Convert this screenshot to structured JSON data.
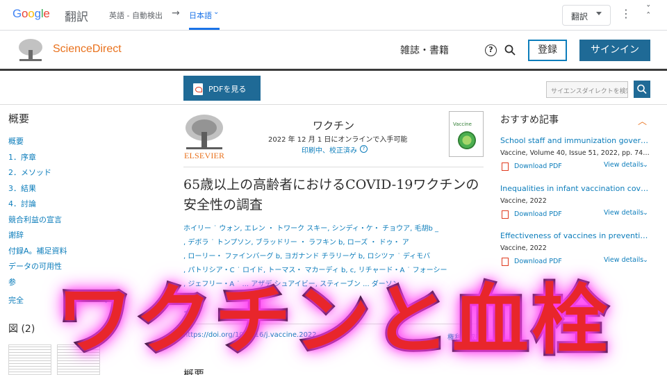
{
  "google_translate": {
    "logo": "Google",
    "service": "翻訳",
    "source_lang": "英語 - 自動検出",
    "arrow": "→",
    "target_lang": "日本語",
    "translate_button": "翻訳",
    "more_icon": "more-vert-icon",
    "collapse_icon": "collapse-icon",
    "logo_colors": [
      "#4285f4",
      "#ea4335",
      "#fbbc05",
      "#4285f4",
      "#34a853",
      "#ea4335"
    ]
  },
  "header": {
    "site_name": "ScienceDirect",
    "journals_books": "雑誌・書籍",
    "help_label": "?",
    "register": "登録",
    "sign_in": "サインイン",
    "accent_color": "#e9711c",
    "button_color": "#1f6a96"
  },
  "toolbar": {
    "pdf_button": "PDFを見る",
    "search_placeholder": "サイエンスダイレクトを検索"
  },
  "outline": {
    "title": "概要",
    "items": [
      "概要",
      "1．序章",
      "2．メソッド",
      "3．結果",
      "4．討論",
      "競合利益の宣言",
      "謝辞",
      "付録A。補足資料",
      "データの可用性",
      "参"
    ],
    "last_item": "完全",
    "figures_title": "図 (2)"
  },
  "article": {
    "publisher": "ELSEVIER",
    "journal": "ワクチン",
    "online_date": "2022 年 12 月 1 日にオンラインで入手可能",
    "status": "印刷中、校正済み",
    "cover_label": "Vaccine",
    "title": "65歳以上の高齢者におけるCOVID-19ワクチンの安全性の調査",
    "author_lines": [
      "ホイリー ˙ ウォン, エレン ・ トワーク スキー, シンディ・ケ・ チョウア, 毛胡b _",
      ", デボラ ˙ トンプソン, ブラッドリー ・ ラフキン b, ローズ ・ ドゥ・ ア",
      ", ローリー・ ファインバーグ b, ヨガナンド チラリーゲ b, ロシツァ ˙ ディモバ",
      ", パトリシア・C ˙ ロイド, トーマス・ マカーディ b, c, リチャード・A ˙ フォーシー",
      ", ジェフリー・A ˙ ... アザデ シュアイビー, スティーブン ... ダーソン"
    ],
    "doi": "https://doi.org/10.1016/j.vaccine.2022...",
    "rights": "権利を取得す",
    "abstract_heading": "概要"
  },
  "recommended": {
    "title": "おすすめ記事",
    "items": [
      {
        "title": "School staff and immunization governance...",
        "meta": "Vaccine, Volume 40, Issue 51, 2022, pp. 7433-7...",
        "download": "Download PDF",
        "details": "View details"
      },
      {
        "title": "Inequalities in infant vaccination coverag...",
        "meta": "Vaccine, 2022",
        "download": "Download PDF",
        "details": "View details"
      },
      {
        "title": "Effectiveness of vaccines in preventing ho...",
        "meta": "Vaccine, 2022",
        "download": "Download PDF",
        "details": "View details"
      }
    ]
  },
  "overlay": {
    "text": "ワクチンと血栓",
    "fill_color": "#e8262b",
    "glow_color": "#ff3df2"
  }
}
